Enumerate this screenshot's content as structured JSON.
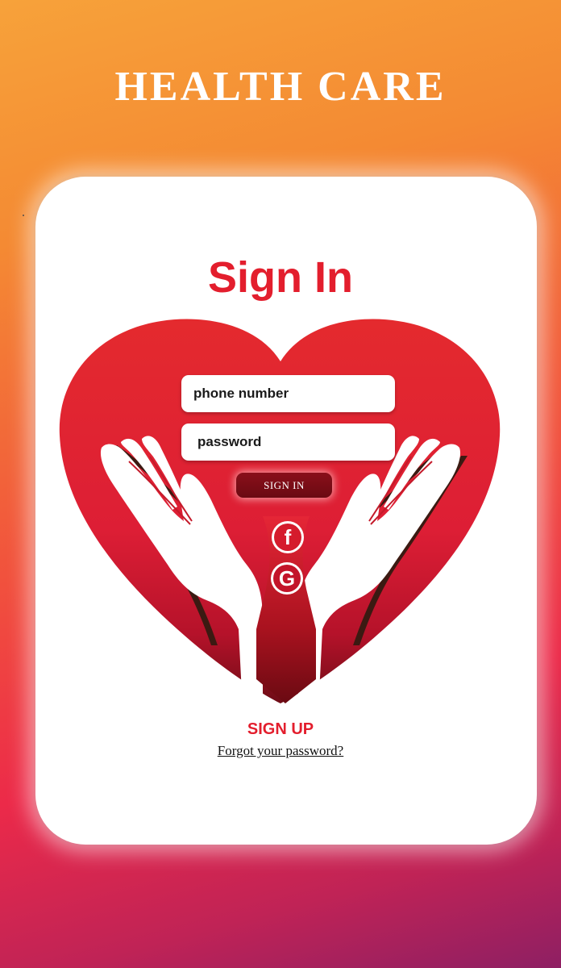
{
  "header": {
    "title": "HEALTH CARE"
  },
  "card": {
    "title": "Sign In"
  },
  "form": {
    "phone_placeholder": "phone number",
    "password_placeholder": "password",
    "signin_label": "SIGN IN"
  },
  "social": {
    "facebook_glyph": "f",
    "google_glyph": "G"
  },
  "footer": {
    "signup_label": "SIGN UP",
    "forgot_label": "Forgot your password?"
  },
  "colors": {
    "accent": "#e31e2d",
    "dark_red": "#6a0a12",
    "background_top": "#f7a23a",
    "background_bottom": "#8e1f63"
  },
  "icons": [
    "heart-hands-illustration",
    "facebook-icon",
    "google-icon"
  ]
}
